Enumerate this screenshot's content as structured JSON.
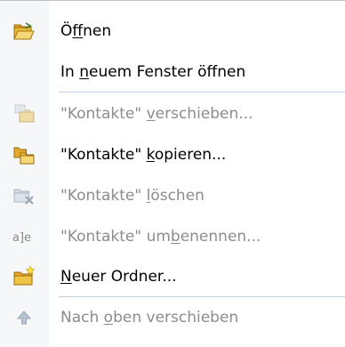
{
  "colors": {
    "gutter": "#f6f7f8",
    "separator": "#c5d3e6",
    "text": "#000000",
    "disabled_text": "#8c8c8c"
  },
  "menu": {
    "items": [
      {
        "id": "oeffnen",
        "icon": "open-folder-icon",
        "enabled": true,
        "label_pre": "Ö",
        "label_key": "f",
        "label_post": "fnen"
      },
      {
        "id": "in-neuem-fenster-oeffnen",
        "icon": "",
        "enabled": true,
        "label_pre": "In ",
        "label_key": "n",
        "label_post": "euem Fenster öffnen"
      },
      {
        "id": "verschieben",
        "icon": "move-folder-icon",
        "enabled": false,
        "label_pre": "\"Kontakte\" ",
        "label_key": "v",
        "label_post": "erschieben..."
      },
      {
        "id": "kopieren",
        "icon": "copy-folder-icon",
        "enabled": true,
        "label_pre": "\"Kontakte\" ",
        "label_key": "k",
        "label_post": "opieren..."
      },
      {
        "id": "loeschen",
        "icon": "delete-folder-icon",
        "enabled": false,
        "label_pre": "\"Kontakte\" ",
        "label_key": "l",
        "label_post": "öschen"
      },
      {
        "id": "umbenennen",
        "icon": "rename-icon",
        "enabled": false,
        "label_pre": "\"Kontakte\" um",
        "label_key": "b",
        "label_post": "enennen..."
      },
      {
        "id": "neuer-ordner",
        "icon": "new-folder-icon",
        "enabled": true,
        "label_pre": "",
        "label_key": "N",
        "label_post": "euer Ordner..."
      },
      {
        "id": "nach-oben-verschieben",
        "icon": "move-up-icon",
        "enabled": false,
        "label_pre": "Nach ",
        "label_key": "o",
        "label_post": "ben verschieben"
      }
    ],
    "rename_icon_glyph": "a]e"
  }
}
